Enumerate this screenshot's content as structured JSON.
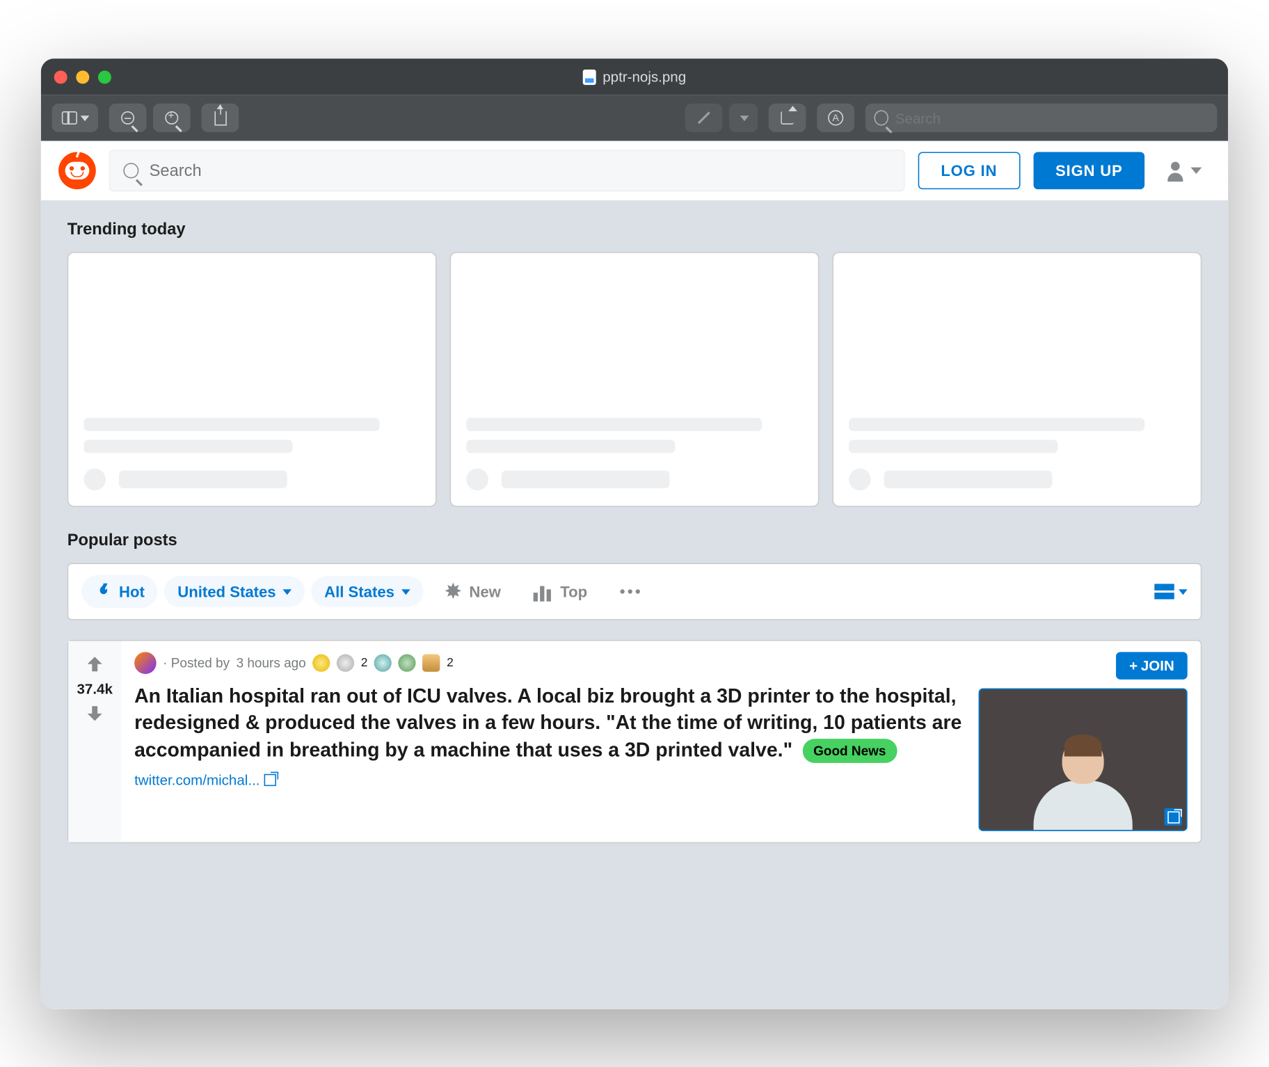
{
  "window": {
    "title": "pptr-nojs.png"
  },
  "macToolbar": {
    "searchPlaceholder": "Search"
  },
  "redditHeader": {
    "searchPlaceholder": "Search",
    "loginLabel": "LOG IN",
    "signupLabel": "SIGN UP"
  },
  "trending": {
    "heading": "Trending today"
  },
  "popular": {
    "heading": "Popular posts"
  },
  "sort": {
    "hot": "Hot",
    "geo1": "United States",
    "geo2": "All States",
    "new": "New",
    "top": "Top"
  },
  "post": {
    "score": "37.4k",
    "postedByPrefix": "· Posted by",
    "age": "3 hours ago",
    "awardCount1": "2",
    "awardCount2": "2",
    "title": "An Italian hospital ran out of ICU valves. A local biz brought a 3D printer to the hospital, redesigned & produced the valves in a few hours. \"At the time of writing, 10 patients are accompanied in breathing by a machine that uses a 3D printed valve.\"",
    "flair": "Good News",
    "linkText": "twitter.com/michal...",
    "joinLabel": "JOIN"
  }
}
